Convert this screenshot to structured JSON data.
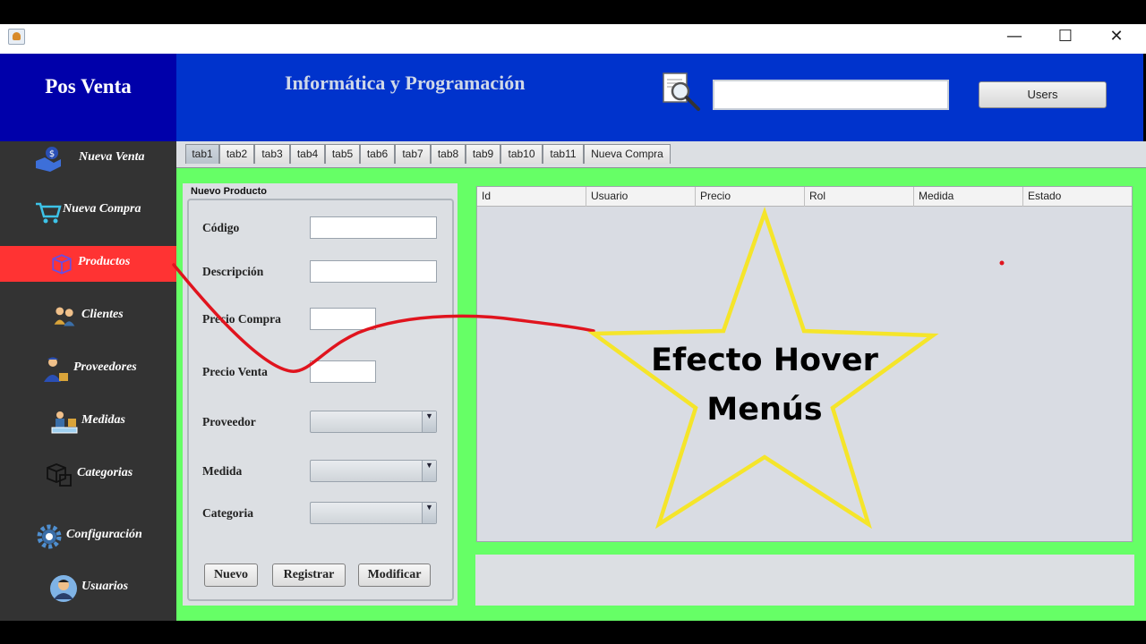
{
  "window": {
    "controls": {
      "minimize": "—",
      "maximize": "☐",
      "close": "✕"
    }
  },
  "header": {
    "logo": "Pos Venta",
    "title": "Informática y Programación",
    "search_value": "",
    "users_button": "Users"
  },
  "sidebar": {
    "items": [
      {
        "label": "Nueva Venta",
        "icon": "hand-money-icon"
      },
      {
        "label": "Nueva Compra",
        "icon": "cart-icon"
      },
      {
        "label": "Productos",
        "icon": "box-icon",
        "active": true
      },
      {
        "label": "Clientes",
        "icon": "people-icon"
      },
      {
        "label": "Proveedores",
        "icon": "delivery-person-icon"
      },
      {
        "label": "Medidas",
        "icon": "measure-icon"
      },
      {
        "label": "Categorias",
        "icon": "boxes-icon"
      },
      {
        "label": "Configuración",
        "icon": "gear-icon"
      },
      {
        "label": "Usuarios",
        "icon": "user-avatar-icon"
      }
    ]
  },
  "tabs": [
    "tab1",
    "tab2",
    "tab3",
    "tab4",
    "tab5",
    "tab6",
    "tab7",
    "tab8",
    "tab9",
    "tab10",
    "tab11",
    "Nueva Compra"
  ],
  "form": {
    "title": "Nuevo Producto",
    "labels": {
      "codigo": "Código",
      "descripcion": "Descripción",
      "precio_compra": "Precio Compra",
      "precio_venta": "Precio Venta",
      "proveedor": "Proveedor",
      "medida": "Medida",
      "categoria": "Categoria"
    },
    "values": {
      "codigo": "",
      "descripcion": "",
      "precio_compra": "",
      "precio_venta": ""
    },
    "buttons": {
      "nuevo": "Nuevo",
      "registrar": "Registrar",
      "modificar": "Modificar"
    }
  },
  "table": {
    "columns": [
      "Id",
      "Usuario",
      "Precio",
      "Rol",
      "Medida",
      "Estado"
    ]
  },
  "annotation": {
    "line1": "Efecto Hover",
    "line2": "Menús",
    "colors": {
      "star": "#f5e52a",
      "line": "#e0141e"
    }
  },
  "colors": {
    "sidebar_active": "#ff3333",
    "sidebar_bg": "#333333",
    "header_bg": "#0033cc",
    "logo_bg": "#0000aa",
    "content_bg": "#66ff66"
  }
}
